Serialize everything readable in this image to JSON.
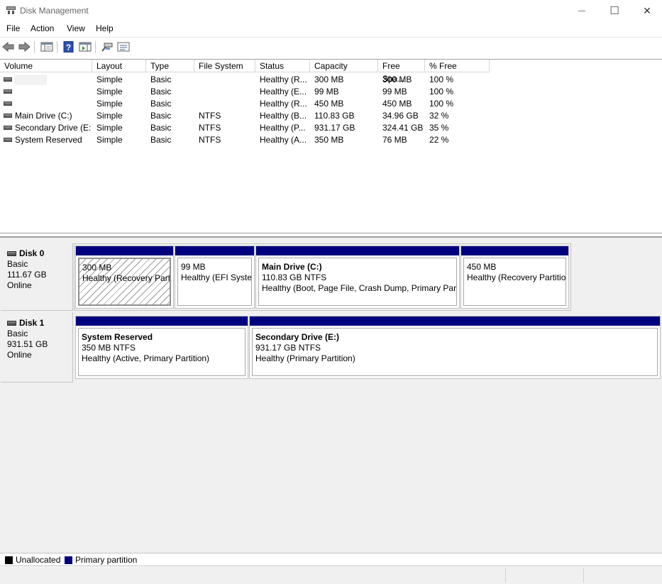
{
  "window": {
    "title": "Disk Management",
    "minimize_glyph": "—",
    "maximize_glyph": "☐",
    "close_glyph": "✕"
  },
  "menu": [
    "File",
    "Action",
    "View",
    "Help"
  ],
  "toolbar": {
    "icons": [
      "back-arrow-icon",
      "forward-arrow-icon",
      "show-hide-console-tree-icon",
      "help-icon",
      "action-pane-icon",
      "connect-icon",
      "properties-icon"
    ]
  },
  "volume_list": {
    "columns": [
      "Volume",
      "Layout",
      "Type",
      "File System",
      "Status",
      "Capacity",
      "Free Spa...",
      "% Free"
    ],
    "rows": [
      {
        "volume": "",
        "layout": "Simple",
        "type": "Basic",
        "fs": "",
        "status": "Healthy (R...",
        "capacity": "300 MB",
        "free": "300 MB",
        "pct": "100 %"
      },
      {
        "volume": "",
        "layout": "Simple",
        "type": "Basic",
        "fs": "",
        "status": "Healthy (E...",
        "capacity": "99 MB",
        "free": "99 MB",
        "pct": "100 %"
      },
      {
        "volume": "",
        "layout": "Simple",
        "type": "Basic",
        "fs": "",
        "status": "Healthy (R...",
        "capacity": "450 MB",
        "free": "450 MB",
        "pct": "100 %"
      },
      {
        "volume": "Main Drive (C:)",
        "layout": "Simple",
        "type": "Basic",
        "fs": "NTFS",
        "status": "Healthy (B...",
        "capacity": "110.83 GB",
        "free": "34.96 GB",
        "pct": "32 %"
      },
      {
        "volume": "Secondary Drive (E:)",
        "layout": "Simple",
        "type": "Basic",
        "fs": "NTFS",
        "status": "Healthy (P...",
        "capacity": "931.17 GB",
        "free": "324.41 GB",
        "pct": "35 %"
      },
      {
        "volume": "System Reserved",
        "layout": "Simple",
        "type": "Basic",
        "fs": "NTFS",
        "status": "Healthy (A...",
        "capacity": "350 MB",
        "free": "76 MB",
        "pct": "22 %"
      }
    ]
  },
  "disks": [
    {
      "name": "Disk 0",
      "type": "Basic",
      "size": "111.67 GB",
      "state": "Online",
      "partitions": [
        {
          "title": "",
          "line1": "300 MB",
          "line2": "Healthy (Recovery Partit"
        },
        {
          "title": "",
          "line1": "99 MB",
          "line2": "Healthy (EFI Syster"
        },
        {
          "title": "Main Drive  (C:)",
          "line1": "110.83 GB NTFS",
          "line2": "Healthy (Boot, Page File, Crash Dump, Primary Parti"
        },
        {
          "title": "",
          "line1": "450 MB",
          "line2": "Healthy (Recovery Partitio"
        }
      ]
    },
    {
      "name": "Disk 1",
      "type": "Basic",
      "size": "931.51 GB",
      "state": "Online",
      "partitions": [
        {
          "title": "System Reserved",
          "line1": "350 MB NTFS",
          "line2": "Healthy (Active, Primary Partition)"
        },
        {
          "title": "Secondary Drive  (E:)",
          "line1": "931.17 GB NTFS",
          "line2": "Healthy (Primary Partition)"
        }
      ]
    }
  ],
  "legend": [
    {
      "label": "Unallocated",
      "color": "#000000"
    },
    {
      "label": "Primary partition",
      "color": "#00007e"
    }
  ],
  "colors": {
    "primary_partition_bar": "#00007e"
  }
}
